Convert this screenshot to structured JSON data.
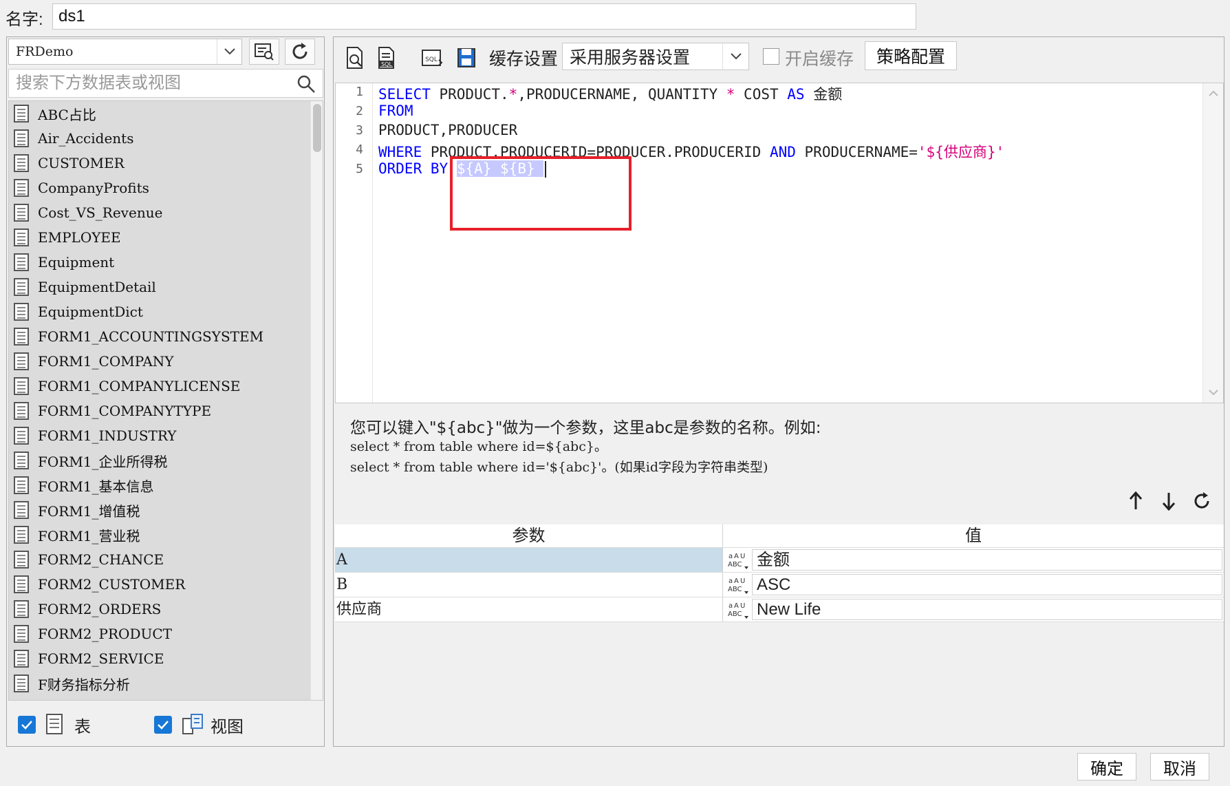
{
  "name_row": {
    "label": "名字:",
    "value": "ds1"
  },
  "left": {
    "connection": "FRDemo",
    "search_placeholder": "搜索下方数据表或视图",
    "tables": [
      "ABC占比",
      "Air_Accidents",
      "CUSTOMER",
      "CompanyProfits",
      "Cost_VS_Revenue",
      "EMPLOYEE",
      "Equipment",
      "EquipmentDetail",
      "EquipmentDict",
      "FORM1_ACCOUNTINGSYSTEM",
      "FORM1_COMPANY",
      "FORM1_COMPANYLICENSE",
      "FORM1_COMPANYTYPE",
      "FORM1_INDUSTRY",
      "FORM1_企业所得税",
      "FORM1_基本信息",
      "FORM1_增值税",
      "FORM1_营业税",
      "FORM2_CHANCE",
      "FORM2_CUSTOMER",
      "FORM2_ORDERS",
      "FORM2_PRODUCT",
      "FORM2_SERVICE",
      "F财务指标分析"
    ],
    "filter_table_label": "表",
    "filter_view_label": "视图"
  },
  "toolbar": {
    "cache_label": "缓存设置",
    "cache_option": "采用服务器设置",
    "enable_cache_label": "开启缓存",
    "strategy_label": "策略配置"
  },
  "sql": {
    "line_numbers": [
      "1",
      "2",
      "3",
      "4",
      "5"
    ],
    "line1": {
      "kw1": "SELECT",
      "mid": " PRODUCT.",
      "star1": "*",
      "mid2": ",PRODUCERNAME, QUANTITY ",
      "star2": "*",
      "mid3": " COST ",
      "kw2": "AS",
      "tail": " 金额"
    },
    "line2": {
      "kw": "FROM"
    },
    "line3": {
      "text": "PRODUCT,PRODUCER"
    },
    "line4": {
      "kw1": "WHERE",
      "mid": " PRODUCT.PRODUCERID=PRODUCER.PRODUCERID ",
      "kw2": "AND",
      "mid2": " PRODUCERNAME=",
      "str": "'${供应商}'"
    },
    "line5": {
      "kw": "ORDER BY",
      "selected": "${A} ${B} "
    }
  },
  "hint": {
    "line1": "您可以键入\"${abc}\"做为一个参数，这里abc是参数的名称。例如:",
    "line2": "select * from table where id=${abc}。",
    "line3": "select * from table where id='${abc}'。(如果id字段为字符串类型)"
  },
  "params": {
    "header_param": "参数",
    "header_value": "值",
    "rows": [
      {
        "name": "A",
        "value": "金额"
      },
      {
        "name": "B",
        "value": "ASC"
      },
      {
        "name": "供应商",
        "value": "New Life"
      }
    ]
  },
  "footer": {
    "ok": "确定",
    "cancel": "取消"
  },
  "colors": {
    "keyword": "#0000ff",
    "string": "#d6007a",
    "highlight_box": "#e6202a",
    "checkbox": "#1677d6",
    "selected_row": "#c8dcea"
  }
}
